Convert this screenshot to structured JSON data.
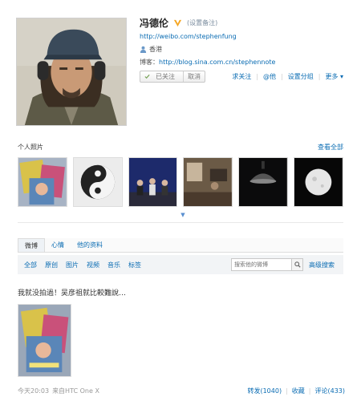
{
  "profile": {
    "name": "冯德伦",
    "set_note": "(设置备注)",
    "weibo_url": "http://weibo.com/stephenfung",
    "location": "香港",
    "blog_label": "博客：",
    "blog_url": "http://blog.sina.com.cn/stephennote",
    "followed_label": "已关注",
    "cancel_label": "取消",
    "actions": [
      "求关注",
      "@他",
      "设置分组",
      "更多"
    ],
    "verified_color": "#f5a623"
  },
  "photos": {
    "title": "个人照片",
    "view_all": "查看全部",
    "items": [
      "magazine-stack",
      "black-white-sculpture",
      "stage-panel",
      "indoor-room",
      "dark-lamp",
      "moon-ball"
    ]
  },
  "tabs": [
    "微博",
    "心情",
    "他的资料"
  ],
  "subtabs": [
    "全部",
    "原创",
    "图片",
    "视频",
    "音乐",
    "标签"
  ],
  "search": {
    "placeholder": "搜索他的微博",
    "advanced": "高级搜索"
  },
  "post": {
    "text": "我就没拍過！吴彦祖就比較難說…",
    "time": "今天20:03",
    "source": "来自HTC One X",
    "repost": "转发(1040)",
    "favorite": "收藏",
    "comment": "评论(433)"
  }
}
